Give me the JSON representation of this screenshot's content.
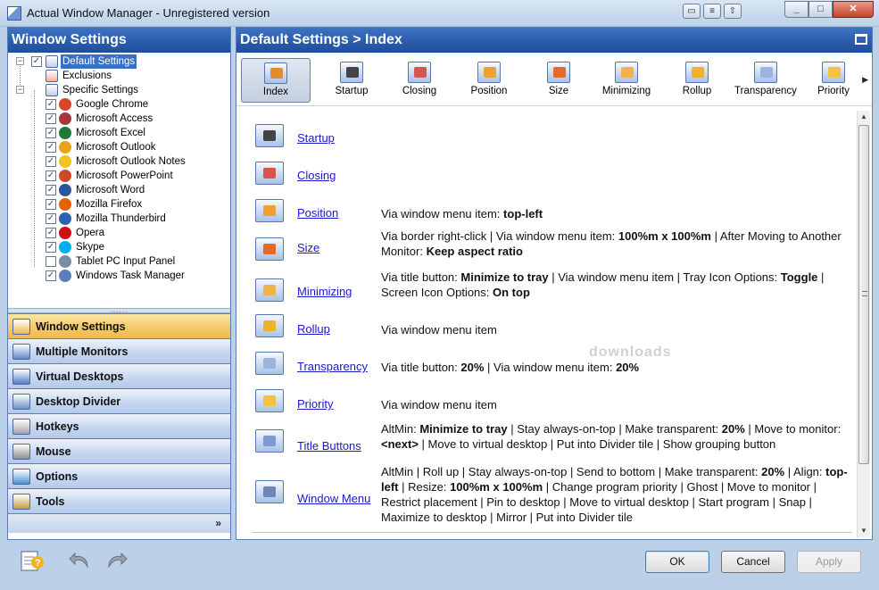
{
  "window": {
    "title": "Actual Window Manager - Unregistered version",
    "controls": {
      "minimize": "_",
      "maximize": "□",
      "close": "✕"
    }
  },
  "left_panel": {
    "title": "Window Settings",
    "tree": [
      {
        "label": "Default Settings",
        "checked": true,
        "selected": true
      },
      {
        "label": "Exclusions"
      },
      {
        "label": "Specific Settings",
        "expanded": true
      },
      {
        "label": "Google Chrome",
        "checked": true,
        "icon_color": "#d9442b"
      },
      {
        "label": "Microsoft Access",
        "checked": true,
        "icon_color": "#a4373a"
      },
      {
        "label": "Microsoft Excel",
        "checked": true,
        "icon_color": "#1f7a3a"
      },
      {
        "label": "Microsoft Outlook",
        "checked": true,
        "icon_color": "#e8a317"
      },
      {
        "label": "Microsoft Outlook Notes",
        "checked": true,
        "icon_color": "#f3c41b"
      },
      {
        "label": "Microsoft PowerPoint",
        "checked": true,
        "icon_color": "#d24726"
      },
      {
        "label": "Microsoft Word",
        "checked": true,
        "icon_color": "#2b579a"
      },
      {
        "label": "Mozilla Firefox",
        "checked": true,
        "icon_color": "#e66000"
      },
      {
        "label": "Mozilla Thunderbird",
        "checked": true,
        "icon_color": "#2a64b0"
      },
      {
        "label": "Opera",
        "checked": true,
        "icon_color": "#cc0f16"
      },
      {
        "label": "Skype",
        "checked": true,
        "icon_color": "#00aff0"
      },
      {
        "label": "Tablet PC Input Panel",
        "checked": false,
        "icon_color": "#7a8ba6"
      },
      {
        "label": "Windows Task Manager",
        "checked": true,
        "icon_color": "#5b7fb8"
      }
    ],
    "nav": [
      {
        "label": "Window Settings",
        "active": true,
        "icon_color": "#e7b94a"
      },
      {
        "label": "Multiple Monitors",
        "icon_color": "#5c86c9"
      },
      {
        "label": "Virtual Desktops",
        "icon_color": "#4f7cc2"
      },
      {
        "label": "Desktop Divider",
        "icon_color": "#6c8fc9"
      },
      {
        "label": "Hotkeys",
        "icon_color": "#a3a3a3"
      },
      {
        "label": "Mouse",
        "icon_color": "#8c8c8c"
      },
      {
        "label": "Options",
        "icon_color": "#4a8fd0"
      },
      {
        "label": "Tools",
        "icon_color": "#c79a3f"
      }
    ],
    "more": "»"
  },
  "right_panel": {
    "title": "Default Settings > Index",
    "toolbar": [
      {
        "label": "Index",
        "active": true,
        "accent": "#e08c2f"
      },
      {
        "label": "Startup",
        "accent": "#444444"
      },
      {
        "label": "Closing",
        "accent": "#d9534f"
      },
      {
        "label": "Position",
        "accent": "#f0a030"
      },
      {
        "label": "Size",
        "accent": "#e06b2a"
      },
      {
        "label": "Minimizing",
        "accent": "#f1b24a"
      },
      {
        "label": "Rollup",
        "accent": "#f0b030"
      },
      {
        "label": "Transparency",
        "accent": "#9ab4dd"
      },
      {
        "label": "Priority",
        "accent": "#f5c142"
      }
    ],
    "items": [
      {
        "link": "Startup",
        "accent": "#444444",
        "desc": []
      },
      {
        "link": "Closing",
        "accent": "#d9534f",
        "desc": []
      },
      {
        "link": "Position",
        "accent": "#f0a030",
        "desc": [
          [
            "Via window menu item: ",
            false
          ],
          [
            "top-left",
            true
          ]
        ]
      },
      {
        "link": "Size",
        "accent": "#e06b2a",
        "desc": [
          [
            "Via border right-click | Via window menu item: ",
            false
          ],
          [
            "100%m x 100%m",
            true
          ],
          [
            " | After Moving to Another Monitor: ",
            false
          ],
          [
            "Keep aspect ratio",
            true
          ]
        ]
      },
      {
        "link": "Minimizing",
        "accent": "#f1b24a",
        "desc": [
          [
            "Via title button: ",
            false
          ],
          [
            "Minimize to tray",
            true
          ],
          [
            " | Via window menu item | Tray Icon Options: ",
            false
          ],
          [
            "Toggle",
            true
          ],
          [
            " | Screen Icon Options: ",
            false
          ],
          [
            "On top",
            true
          ]
        ]
      },
      {
        "link": "Rollup",
        "accent": "#f0b030",
        "desc": [
          [
            "Via window menu item",
            false
          ]
        ]
      },
      {
        "link": "Transparency",
        "accent": "#9ab4dd",
        "desc": [
          [
            "Via title button: ",
            false
          ],
          [
            "20%",
            true
          ],
          [
            " | Via window menu item: ",
            false
          ],
          [
            "20%",
            true
          ]
        ]
      },
      {
        "link": "Priority",
        "accent": "#f5c142",
        "desc": [
          [
            "Via window menu item",
            false
          ]
        ]
      },
      {
        "link": "Title Buttons",
        "accent": "#7d9bd0",
        "desc": [
          [
            "AltMin: ",
            false
          ],
          [
            "Minimize to tray",
            true
          ],
          [
            " | Stay always-on-top | Make transparent: ",
            false
          ],
          [
            "20%",
            true
          ],
          [
            " | Move to monitor: ",
            false
          ],
          [
            "<next>",
            true
          ],
          [
            " | Move to virtual desktop | Put into Divider tile | Show grouping button",
            false
          ]
        ]
      },
      {
        "link": "Window Menu",
        "accent": "#6e86b3",
        "desc": [
          [
            "AltMin | Roll up | Stay always-on-top | Send to bottom | Make transparent: ",
            false
          ],
          [
            "20%",
            true
          ],
          [
            " | Align: ",
            false
          ],
          [
            "top-left",
            true
          ],
          [
            " | Resize: ",
            false
          ],
          [
            "100%m x 100%m",
            true
          ],
          [
            " | Change program priority | Ghost | Move to monitor | Restrict placement | Pin to desktop | Move to virtual desktop | Start program | Snap | Maximize to desktop | Mirror | Put into Divider tile",
            false
          ]
        ]
      }
    ],
    "watermark": "downloads"
  },
  "buttons": {
    "ok": "OK",
    "cancel": "Cancel",
    "apply": "Apply"
  },
  "bottom_icons": {
    "help": "help-icon",
    "undo": "undo-icon",
    "redo": "redo-icon"
  }
}
